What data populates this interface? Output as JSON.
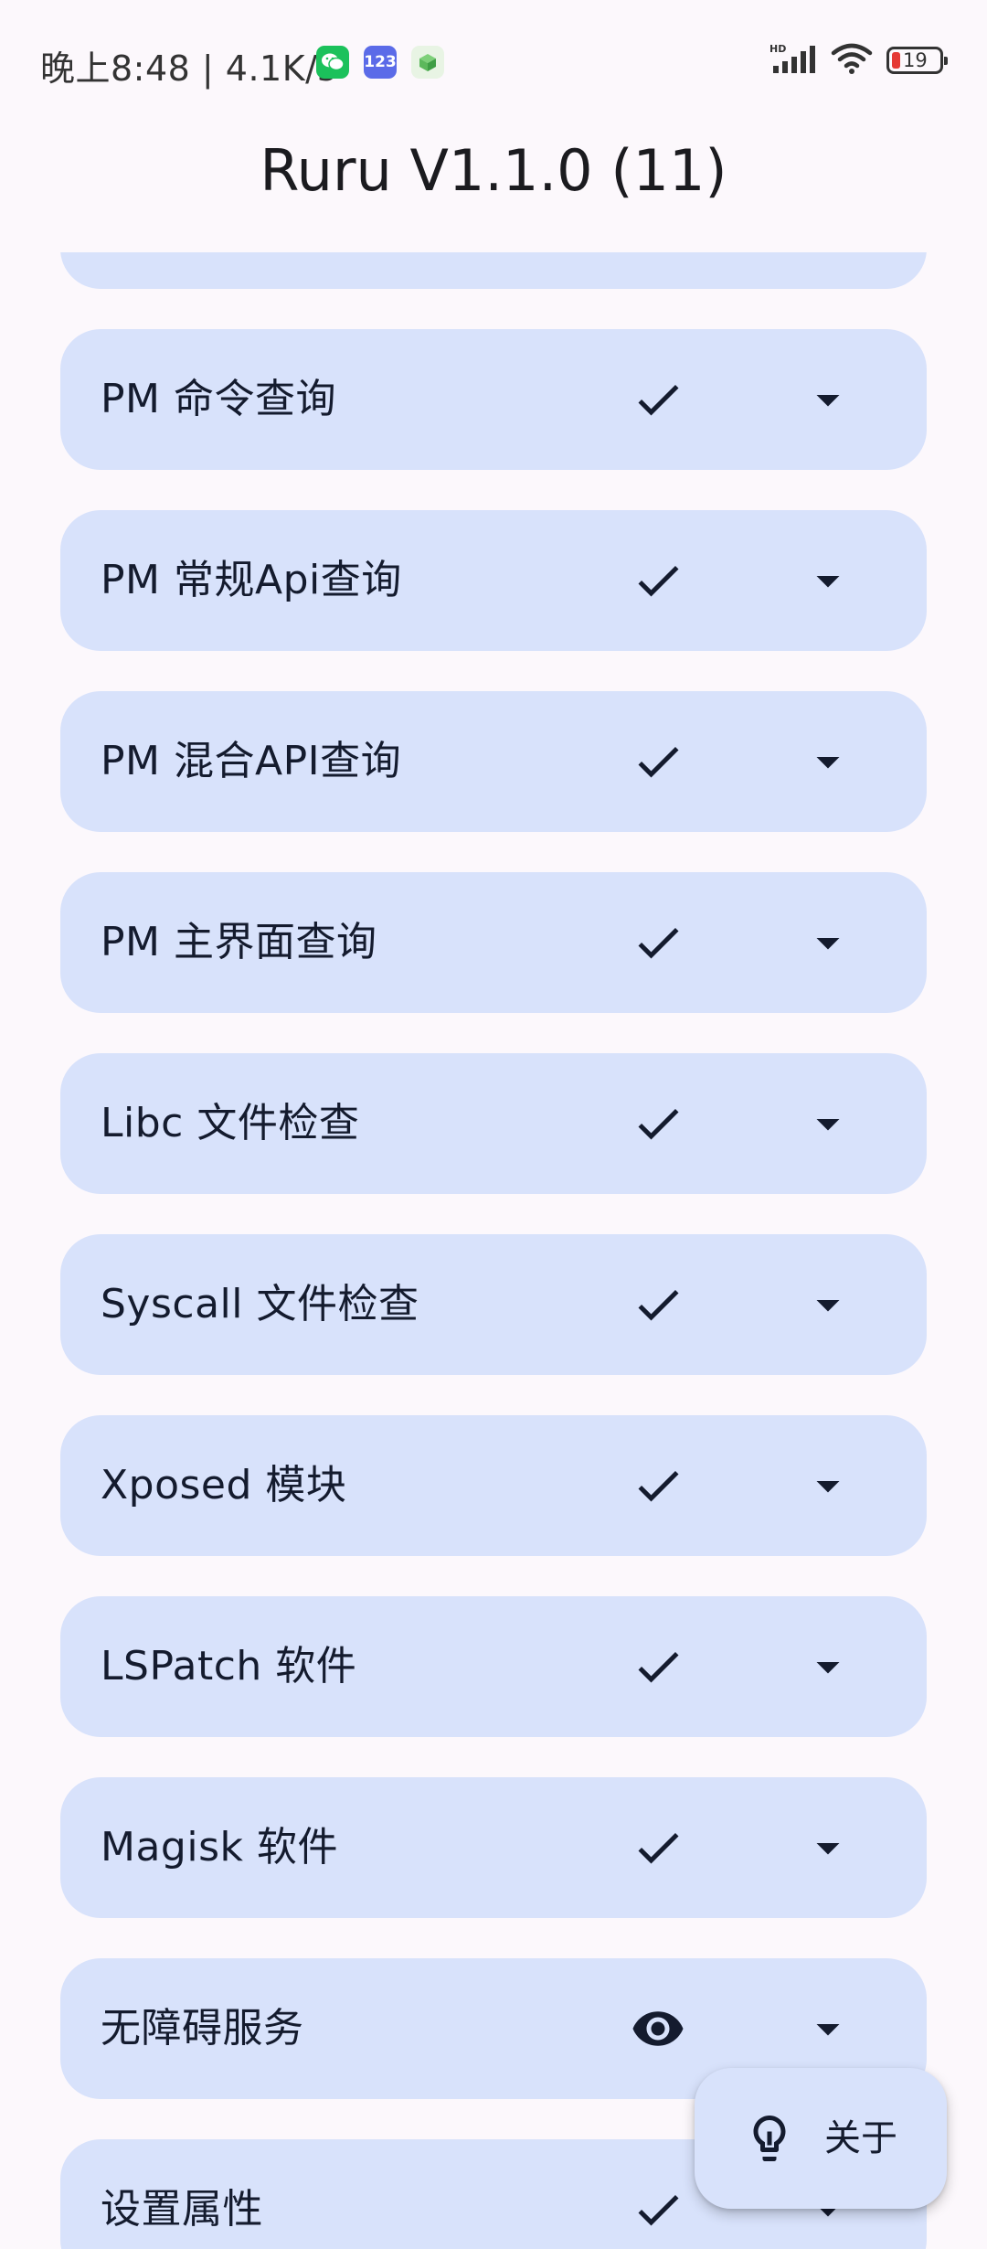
{
  "status_bar": {
    "time_and_speed": "晚上8:48 | 4.1K/s",
    "app_123_label": "123",
    "network_label": "HD",
    "battery_level": "19"
  },
  "header": {
    "title": "Ruru V1.1.0 (11)"
  },
  "detections": [
    {
      "label": "PM 命令查询",
      "status_icon": "check-icon"
    },
    {
      "label": "PM 常规Api查询",
      "status_icon": "check-icon"
    },
    {
      "label": "PM 混合API查询",
      "status_icon": "check-icon"
    },
    {
      "label": "PM 主界面查询",
      "status_icon": "check-icon"
    },
    {
      "label": "Libc 文件检查",
      "status_icon": "check-icon"
    },
    {
      "label": "Syscall 文件检查",
      "status_icon": "check-icon"
    },
    {
      "label": "Xposed 模块",
      "status_icon": "check-icon"
    },
    {
      "label": "LSPatch 软件",
      "status_icon": "check-icon"
    },
    {
      "label": "Magisk 软件",
      "status_icon": "check-icon"
    },
    {
      "label": "无障碍服务",
      "status_icon": "eye-icon"
    },
    {
      "label": "设置属性",
      "status_icon": "check-icon"
    }
  ],
  "fab": {
    "label": "关于",
    "icon": "lightbulb-icon"
  },
  "colors": {
    "background": "#FCF8FC",
    "card": "#D8E2FB",
    "icon": "#141B2E",
    "battery_low": "#E53935"
  }
}
